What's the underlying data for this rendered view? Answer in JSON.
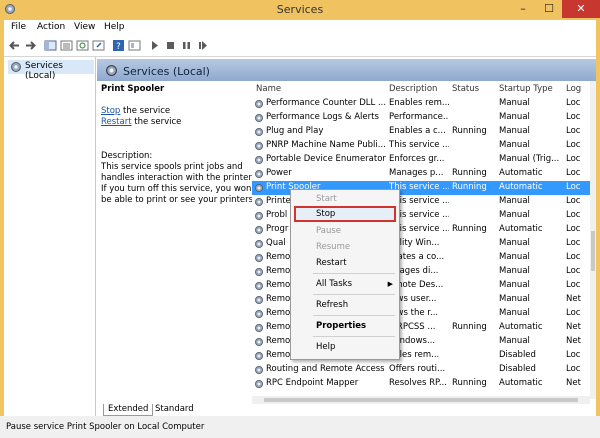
{
  "window": {
    "title": "Services",
    "min": "–",
    "max": "☐",
    "close": "✕"
  },
  "menu": [
    "File",
    "Action",
    "View",
    "Help"
  ],
  "tree": {
    "item": "Services (Local)"
  },
  "header": {
    "title": "Services (Local)"
  },
  "description": {
    "service_name": "Print Spooler",
    "stop_link": "Stop",
    "stop_rest": " the service",
    "restart_link": "Restart",
    "restart_rest": " the service",
    "label": "Description:",
    "lines": [
      "This service spools print jobs and",
      "handles interaction with the printer.",
      "If you turn off this service, you won't",
      "be able to print or see your printers."
    ]
  },
  "columns": {
    "name": "Name",
    "description": "Description",
    "status": "Status",
    "startup": "Startup Type",
    "logon": "Log"
  },
  "rows": [
    {
      "name": "Performance Counter DLL ...",
      "desc": "Enables rem...",
      "status": "",
      "startup": "Manual",
      "logon": "Loc"
    },
    {
      "name": "Performance Logs & Alerts",
      "desc": "Performance...",
      "status": "",
      "startup": "Manual",
      "logon": "Loc"
    },
    {
      "name": "Plug and Play",
      "desc": "Enables a c...",
      "status": "Running",
      "startup": "Manual",
      "logon": "Loc"
    },
    {
      "name": "PNRP Machine Name Publi...",
      "desc": "This service ...",
      "status": "",
      "startup": "Manual",
      "logon": "Loc"
    },
    {
      "name": "Portable Device Enumerator...",
      "desc": "Enforces gr...",
      "status": "",
      "startup": "Manual (Trig...",
      "logon": "Loc"
    },
    {
      "name": "Power",
      "desc": "Manages p...",
      "status": "Running",
      "startup": "Automatic",
      "logon": "Loc"
    },
    {
      "name": "Print Spooler",
      "desc": "This service ...",
      "status": "Running",
      "startup": "Automatic",
      "logon": "Loc"
    },
    {
      "name": "Printe",
      "desc": "This service ...",
      "status": "",
      "startup": "Manual",
      "logon": "Loc"
    },
    {
      "name": "Probl",
      "desc": "This service ...",
      "status": "",
      "startup": "Manual",
      "logon": "Loc"
    },
    {
      "name": "Progr",
      "desc": "This service ...",
      "status": "Running",
      "startup": "Automatic",
      "logon": "Loc"
    },
    {
      "name": "Qual",
      "desc": "uality Win...",
      "status": "",
      "startup": "Manual",
      "logon": "Loc"
    },
    {
      "name": "Remo",
      "desc": "reates a co...",
      "status": "",
      "startup": "Manual",
      "logon": "Loc"
    },
    {
      "name": "Remo",
      "desc": "anages di...",
      "status": "",
      "startup": "Manual",
      "logon": "Loc"
    },
    {
      "name": "Remo",
      "desc": "emote Des...",
      "status": "",
      "startup": "Manual",
      "logon": "Loc"
    },
    {
      "name": "Remo",
      "desc": "lows user...",
      "status": "",
      "startup": "Manual",
      "logon": "Net"
    },
    {
      "name": "Remo",
      "desc": "lows the r...",
      "status": "",
      "startup": "Manual",
      "logon": "Loc"
    },
    {
      "name": "Remo",
      "desc": "e RPCSS ...",
      "status": "Running",
      "startup": "Automatic",
      "logon": "Net"
    },
    {
      "name": "Remo",
      "desc": "Windows...",
      "status": "",
      "startup": "Manual",
      "logon": "Net"
    },
    {
      "name": "Remo",
      "desc": "ables rem...",
      "status": "",
      "startup": "Disabled",
      "logon": "Loc"
    },
    {
      "name": "Routing and Remote Access",
      "desc": "Offers routi...",
      "status": "",
      "startup": "Disabled",
      "logon": "Loc"
    },
    {
      "name": "RPC Endpoint Mapper",
      "desc": "Resolves RP...",
      "status": "Running",
      "startup": "Automatic",
      "logon": "Net"
    }
  ],
  "context_menu": {
    "start": "Start",
    "stop": "Stop",
    "pause": "Pause",
    "resume": "Resume",
    "restart": "Restart",
    "all_tasks": "All Tasks",
    "refresh": "Refresh",
    "properties": "Properties",
    "help": "Help"
  },
  "tabs": {
    "extended": "Extended",
    "standard": "Standard"
  },
  "status_bar": "Pause service Print Spooler on Local Computer",
  "colors": {
    "selection": "#3399ff",
    "accent_title": "#f0c260",
    "highlight_box": "#d0342c"
  }
}
